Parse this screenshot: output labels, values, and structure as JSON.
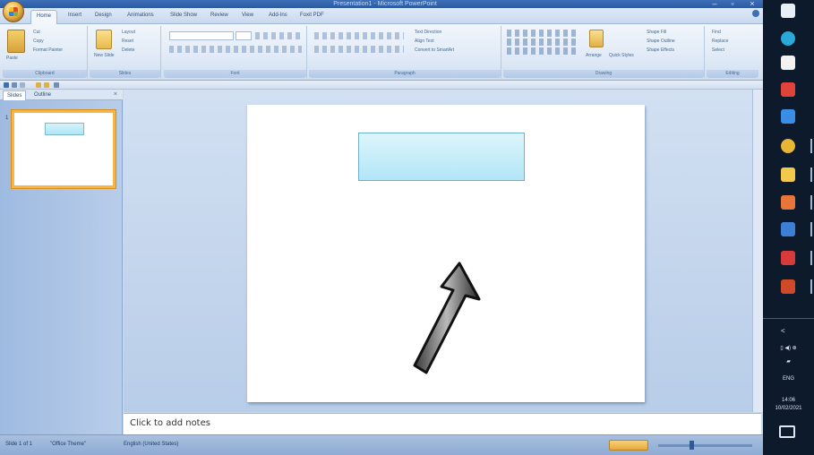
{
  "window": {
    "title": "Presentation1 - Microsoft PowerPoint"
  },
  "ribbon": {
    "tabs": [
      "Home",
      "Insert",
      "Design",
      "Animations",
      "Slide Show",
      "Review",
      "View",
      "Add-Ins",
      "Foxit PDF"
    ],
    "groups": [
      "Clipboard",
      "Slides",
      "Font",
      "Paragraph",
      "Drawing",
      "Editing"
    ],
    "clipboard": {
      "paste": "Paste",
      "cut": "Cut",
      "copy": "Copy",
      "format_painter": "Format Painter"
    },
    "slides": {
      "new_slide": "New Slide",
      "layout": "Layout",
      "reset": "Reset",
      "delete": "Delete"
    },
    "paragraph": {
      "text_direction": "Text Direction",
      "align_text": "Align Text",
      "convert": "Convert to SmartArt"
    },
    "drawing": {
      "arrange": "Arrange",
      "quick_styles": "Quick Styles",
      "shape_fill": "Shape Fill",
      "shape_outline": "Shape Outline",
      "shape_effects": "Shape Effects"
    },
    "editing": {
      "find": "Find",
      "replace": "Replace",
      "select": "Select"
    }
  },
  "left_pane": {
    "tabs": [
      "Slides",
      "Outline"
    ],
    "close": "×",
    "slide_number": "1"
  },
  "notes": {
    "placeholder": "Click to add notes"
  },
  "status": {
    "slide": "Slide 1 of 1",
    "theme": "\"Office Theme\"",
    "language": "English (United States)"
  },
  "taskbar": {
    "chevron": "<",
    "language": "ENG",
    "time": "14:06",
    "date": "10/02/2021",
    "icons": [
      {
        "name": "windows-start-icon",
        "color": "#e8eef6"
      },
      {
        "name": "edge-icon",
        "color": "#2aa9d8"
      },
      {
        "name": "store-icon",
        "color": "#f2f2f2"
      },
      {
        "name": "calendar-icon",
        "color": "#e0433a"
      },
      {
        "name": "mail-icon",
        "color": "#3a8ee6"
      },
      {
        "name": "chrome-icon",
        "color": "#e9b534"
      },
      {
        "name": "file-explorer-icon",
        "color": "#f2c94c"
      },
      {
        "name": "office-icon",
        "color": "#e8763a"
      },
      {
        "name": "app-blue-icon",
        "color": "#3d7fd6"
      },
      {
        "name": "app-red-icon",
        "color": "#d93a3a"
      },
      {
        "name": "powerpoint-icon",
        "color": "#d04a2a"
      }
    ]
  }
}
